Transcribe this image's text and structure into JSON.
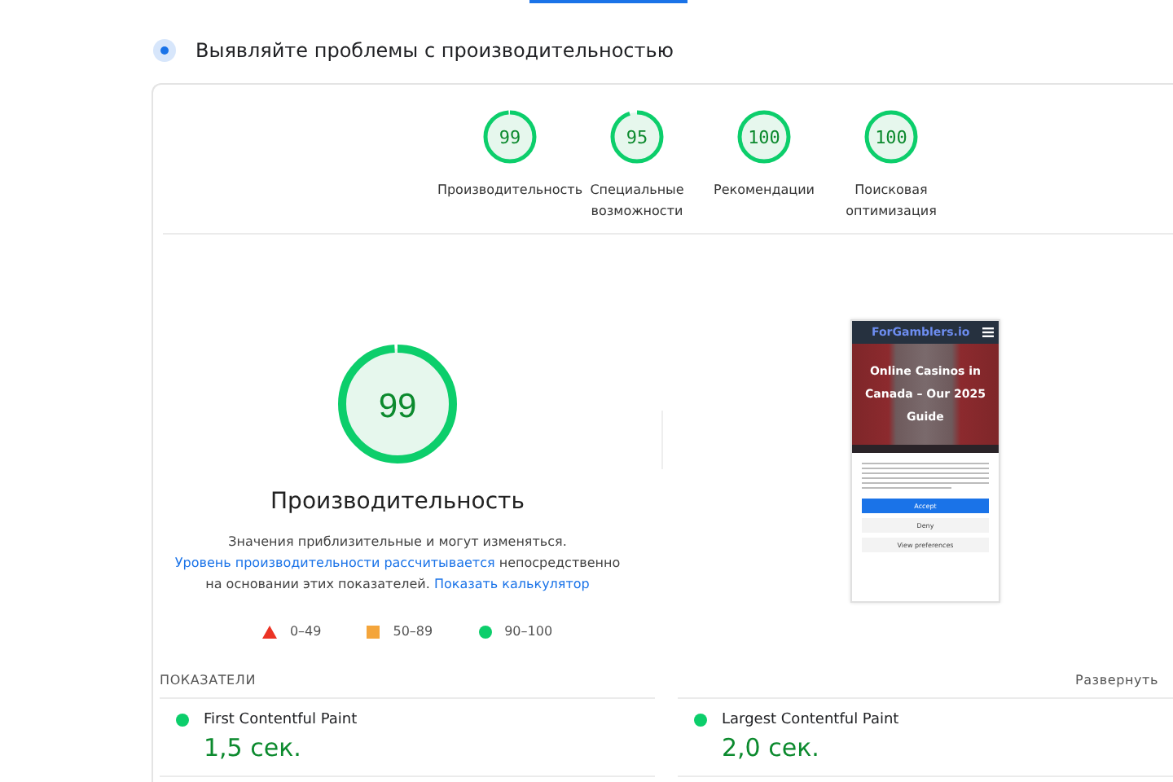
{
  "section_title": "Выявляйте проблемы с производительностью",
  "categories": [
    {
      "score": "99",
      "level": 0.99,
      "label": "Производительность"
    },
    {
      "score": "95",
      "level": 0.95,
      "label": "Специальные возможности"
    },
    {
      "score": "100",
      "level": 1,
      "label": "Рекомендации"
    },
    {
      "score": "100",
      "level": 1,
      "label": "Поисковая оптимизация"
    }
  ],
  "main_gauge": {
    "score": "99",
    "level": 0.99,
    "title": "Производительность"
  },
  "description": [
    {
      "kind": "text",
      "text": "Значения приблизительные и могут изменяться. "
    },
    {
      "kind": "link",
      "text": "Уровень производительности рассчитывается"
    },
    {
      "kind": "text",
      "text": " непосредственно на основании этих показателей. "
    },
    {
      "kind": "link",
      "text": "Показать калькулятор"
    }
  ],
  "legend": [
    {
      "kind": "triangle",
      "color": "#eb3324",
      "label": "0–49"
    },
    {
      "kind": "square",
      "color": "#f4a53b",
      "label": "50–89"
    },
    {
      "kind": "circle",
      "color": "#0cce6b",
      "label": "90–100"
    }
  ],
  "screenshot": {
    "site": "ForGamblers.io",
    "headline": "Online Casinos in Canada – Our 2025 Guide",
    "buttons": [
      "Accept",
      "Deny",
      "View preferences"
    ]
  },
  "metrics_title": "ПОКАЗАТЕЛИ",
  "expand": "Развернуть",
  "metrics": [
    {
      "name": "First Contentful Paint",
      "value": "1,5 сек.",
      "color": "#0cce6b"
    },
    {
      "name": "Largest Contentful Paint",
      "value": "2,0 сек.",
      "color": "#0cce6b"
    }
  ]
}
